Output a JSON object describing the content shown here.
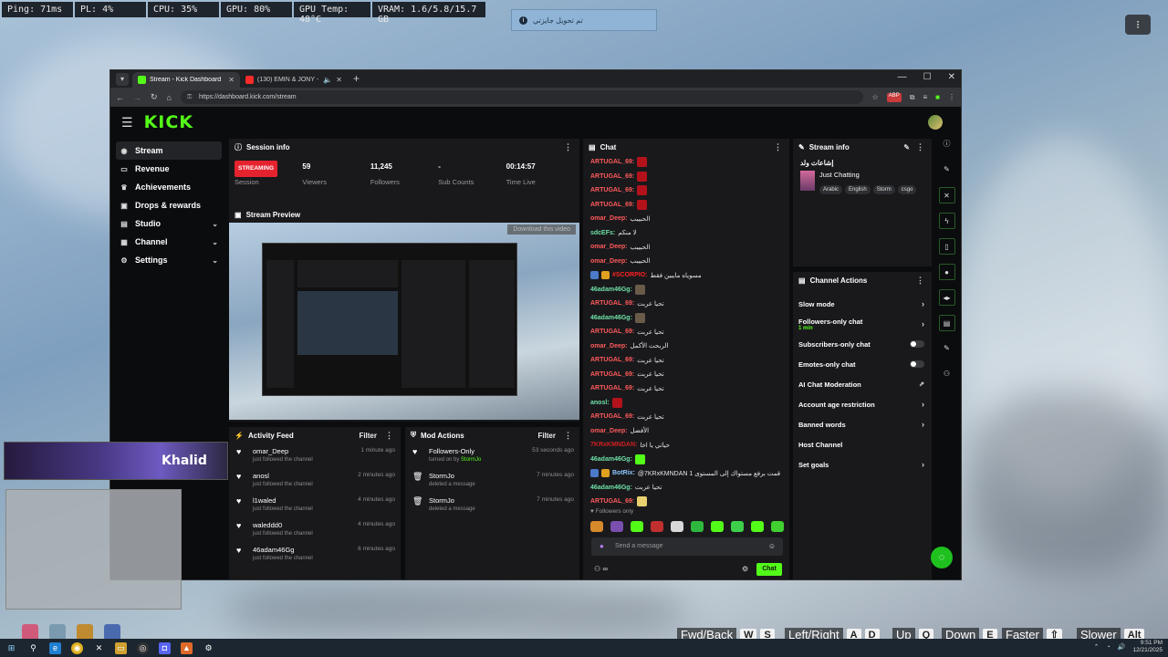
{
  "overlay": {
    "stats": [
      "Ping: 71ms",
      "PL: 4%",
      "CPU: 35%",
      "GPU: 80%",
      "GPU Temp: 48°C",
      "VRAM: 1.6/5.8/15.7 GB"
    ],
    "notification": "تم تحويل جايزتي",
    "corner_button": "⁝"
  },
  "browser": {
    "tabs": [
      {
        "title": "Stream - Kick Dashboard",
        "active": true,
        "fav_color": "#53fc18"
      },
      {
        "title": "(130) EMIN & JONY - Kami...",
        "active": false,
        "fav_color": "#ff2a2a"
      }
    ],
    "url": "https://dashboard.kick.com/stream",
    "controls": {
      "min": "—",
      "max": "☐",
      "close": "✕"
    }
  },
  "kick": {
    "logo": "KICK",
    "sidebar": [
      {
        "label": "Stream",
        "icon": "((•))",
        "active": true,
        "chevron": false
      },
      {
        "label": "Revenue",
        "icon": "▭",
        "active": false,
        "chevron": false
      },
      {
        "label": "Achievements",
        "icon": "🏆",
        "active": false,
        "chevron": false
      },
      {
        "label": "Drops & rewards",
        "icon": "🎁",
        "active": false,
        "chevron": false
      },
      {
        "label": "Studio",
        "icon": "▣",
        "active": false,
        "chevron": true
      },
      {
        "label": "Channel",
        "icon": "▤",
        "active": false,
        "chevron": true
      },
      {
        "label": "Settings",
        "icon": "⚙",
        "active": false,
        "chevron": true
      }
    ],
    "session": {
      "title": "Session info",
      "stats": [
        {
          "value": "STREAMING",
          "label": "Session",
          "badge": true
        },
        {
          "value": "59",
          "label": "Viewers"
        },
        {
          "value": "11,245",
          "label": "Followers"
        },
        {
          "value": "-",
          "label": "Sub Counts"
        },
        {
          "value": "00:14:57",
          "label": "Time Live"
        }
      ]
    },
    "preview": {
      "title": "Stream Preview",
      "download": "Download this video"
    },
    "activity": {
      "title": "Activity Feed",
      "filter": "Filter",
      "rows": [
        {
          "name": "omar_Deep",
          "sub": "just followed the channel",
          "time": "1 minute ago"
        },
        {
          "name": "anosl",
          "sub": "just followed the channel",
          "time": "2 minutes ago"
        },
        {
          "name": "l1waled",
          "sub": "just followed the channel",
          "time": "4 minutes ago"
        },
        {
          "name": "waleddd0",
          "sub": "just followed the channel",
          "time": "4 minutes ago"
        },
        {
          "name": "46adam46Gg",
          "sub": "just followed the channel",
          "time": "6 minutes ago"
        }
      ]
    },
    "mod": {
      "title": "Mod Actions",
      "filter": "Filter",
      "rows": [
        {
          "name": "Followers-Only",
          "sub": "turned on by",
          "by": "StormJo",
          "time": "53 seconds ago",
          "icon": "♥"
        },
        {
          "name": "StormJo",
          "sub": "deleted a message",
          "by": "",
          "time": "7 minutes ago",
          "icon": "🗑"
        },
        {
          "name": "StormJo",
          "sub": "deleted a message",
          "by": "",
          "time": "7 minutes ago",
          "icon": "🗑"
        }
      ]
    },
    "chat": {
      "title": "Chat",
      "lines": [
        {
          "user": "ARTUGAL_69:",
          "color": "#ff5a5a",
          "msg": "",
          "emote": "#b3121b"
        },
        {
          "user": "ARTUGAL_69:",
          "color": "#ff5a5a",
          "msg": "",
          "emote": "#b3121b"
        },
        {
          "user": "ARTUGAL_69:",
          "color": "#ff5a5a",
          "msg": "",
          "emote": "#b3121b"
        },
        {
          "user": "ARTUGAL_69:",
          "color": "#ff5a5a",
          "msg": "",
          "emote": "#b3121b"
        },
        {
          "user": "omar_Deep:",
          "color": "#ff5a5a",
          "msg": "الحبيبب",
          "emote": ""
        },
        {
          "user": "sdcEFs:",
          "color": "#6fe0a6",
          "msg": "لا منكم",
          "emote": ""
        },
        {
          "user": "omar_Deep:",
          "color": "#ff5a5a",
          "msg": "الحبيبب",
          "emote": ""
        },
        {
          "user": "omar_Deep:",
          "color": "#ff5a5a",
          "msg": "الحبيبب",
          "emote": ""
        },
        {
          "user": "#SCORPIO:",
          "color": "#ff2020",
          "msg": "مسوياه مايبين فقط",
          "emote": "",
          "badges": true
        },
        {
          "user": "46adam46Gg:",
          "color": "#6fe0a6",
          "msg": "",
          "emote": "#6a5a4a"
        },
        {
          "user": "ARTUGAL_69:",
          "color": "#ff5a5a",
          "msg": "تحيا عربت",
          "emote": ""
        },
        {
          "user": "46adam46Gg:",
          "color": "#6fe0a6",
          "msg": "",
          "emote": "#6a5a4a"
        },
        {
          "user": "ARTUGAL_69:",
          "color": "#ff5a5a",
          "msg": "تحيا عربت",
          "emote": ""
        },
        {
          "user": "omar_Deep:",
          "color": "#ff5a5a",
          "msg": "الربحت الأكمل",
          "emote": ""
        },
        {
          "user": "ARTUGAL_69:",
          "color": "#ff5a5a",
          "msg": "تحيا عربت",
          "emote": ""
        },
        {
          "user": "ARTUGAL_69:",
          "color": "#ff5a5a",
          "msg": "تحيا عربت",
          "emote": ""
        },
        {
          "user": "ARTUGAL_69:",
          "color": "#ff5a5a",
          "msg": "تحيا عربت",
          "emote": ""
        },
        {
          "user": "anosl:",
          "color": "#6fe0a6",
          "msg": "",
          "emote": "#b3121b"
        },
        {
          "user": "ARTUGAL_69:",
          "color": "#ff5a5a",
          "msg": "تحيا عربت",
          "emote": ""
        },
        {
          "user": "omar_Deep:",
          "color": "#ff5a5a",
          "msg": "الأفضل",
          "emote": ""
        },
        {
          "user": "7KRxKMNDAN:",
          "color": "#d02020",
          "msg": "حياتي يا اخا",
          "emote": ""
        },
        {
          "user": "46adam46Gg:",
          "color": "#6fe0a6",
          "msg": "",
          "emote": "#53fc18"
        },
        {
          "user": "BotRix:",
          "color": "#8ec7ff",
          "msg": "@7KRxKMNDAN 1 قمت برفع مستواك إلى المستوى",
          "emote": "",
          "badges": true
        },
        {
          "user": "46adam46Gg:",
          "color": "#6fe0a6",
          "msg": "تحيا عربت",
          "emote": ""
        },
        {
          "user": "ARTUGAL_69:",
          "color": "#ff5a5a",
          "msg": "",
          "emote": "#e8d070"
        }
      ],
      "followers_only": "Followers only",
      "placeholder": "Send a message",
      "send": "Chat"
    },
    "stream_info": {
      "title": "Stream info",
      "stream_title": "إشاعات ولد",
      "category": "Just Chatting",
      "tags": [
        "Arabic",
        "English",
        "Storm",
        "csgo"
      ]
    },
    "channel_actions": {
      "title": "Channel Actions",
      "rows": [
        {
          "label": "Slow mode",
          "control": "chevron"
        },
        {
          "label": "Followers-only chat",
          "sub": "1 min",
          "control": "chevron"
        },
        {
          "label": "Subscribers-only chat",
          "control": "toggle"
        },
        {
          "label": "Emotes-only chat",
          "control": "toggle"
        },
        {
          "label": "AI Chat Moderation",
          "control": "ext"
        },
        {
          "label": "Account age restriction",
          "control": "chevron"
        },
        {
          "label": "Banned words",
          "control": "chevron"
        },
        {
          "label": "Host Channel",
          "control": ""
        },
        {
          "label": "Set goals",
          "control": "chevron"
        }
      ]
    }
  },
  "game": {
    "player_name": "Khalid",
    "hints": [
      {
        "label": "Fwd/Back",
        "keys": [
          "W",
          "S"
        ]
      },
      {
        "label": "Left/Right",
        "keys": [
          "A",
          "D"
        ]
      },
      {
        "label": "Up",
        "keys": [
          "Q"
        ]
      },
      {
        "label": "Down",
        "keys": [
          "E"
        ]
      },
      {
        "label": "Faster",
        "keys": [
          "⇧"
        ]
      },
      {
        "label": "Slower",
        "keys": [
          "Alt"
        ]
      }
    ]
  },
  "taskbar": {
    "time": "9:51 PM",
    "date": "12/21/2025"
  }
}
